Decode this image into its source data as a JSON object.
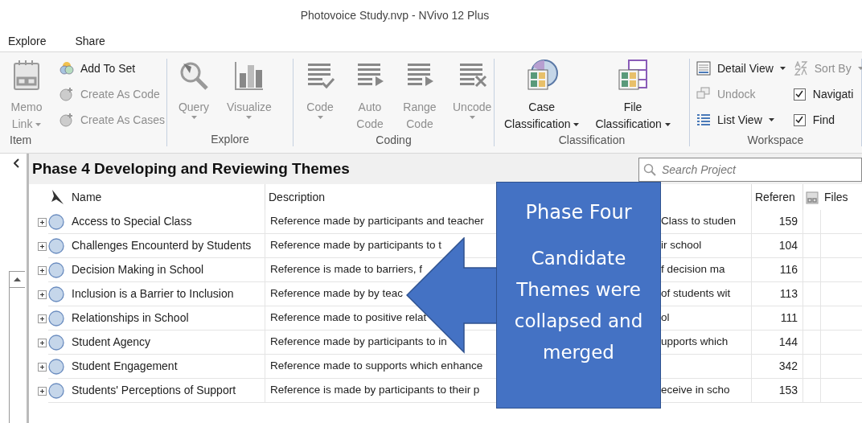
{
  "window": {
    "title": "Photovoice Study.nvp - NVivo 12 Plus"
  },
  "menu": [
    {
      "label": "Explore"
    },
    {
      "label": "Share"
    }
  ],
  "ribbon": [
    {
      "label": "Item",
      "items": [
        {
          "kind": "large",
          "lines": [
            "Memo",
            "Link"
          ],
          "dropdown": true,
          "disabled": true
        },
        {
          "kind": "stack",
          "entries": [
            {
              "label": "Add To Set",
              "dropdown": false,
              "disabled": false
            },
            {
              "label": "Create As Code",
              "dropdown": false,
              "disabled": true
            },
            {
              "label": "Create As Cases",
              "dropdown": false,
              "disabled": true
            }
          ]
        }
      ]
    },
    {
      "label": "Explore",
      "items": [
        {
          "kind": "large",
          "lines": [
            "Query"
          ],
          "dropdown": true,
          "disabled": true
        },
        {
          "kind": "large",
          "lines": [
            "Visualize"
          ],
          "dropdown": true,
          "disabled": true
        }
      ]
    },
    {
      "label": "Coding",
      "items": [
        {
          "kind": "large",
          "lines": [
            "Code"
          ],
          "dropdown": true,
          "disabled": true
        },
        {
          "kind": "large",
          "lines": [
            "Auto",
            "Code"
          ],
          "dropdown": false,
          "disabled": true
        },
        {
          "kind": "large",
          "lines": [
            "Range",
            "Code"
          ],
          "dropdown": false,
          "disabled": true
        },
        {
          "kind": "large",
          "lines": [
            "Uncode"
          ],
          "dropdown": true,
          "disabled": true
        }
      ]
    },
    {
      "label": "Classification",
      "items": [
        {
          "kind": "large",
          "lines": [
            "Case",
            "Classification"
          ],
          "dropdown": true,
          "disabled": false
        },
        {
          "kind": "large",
          "lines": [
            "File",
            "Classification"
          ],
          "dropdown": true,
          "disabled": false
        }
      ]
    },
    {
      "label": "Workspace",
      "items": [
        {
          "kind": "stack",
          "entries": [
            {
              "label": "Detail View",
              "dropdown": true,
              "disabled": false
            },
            {
              "label": "Undock",
              "dropdown": false,
              "disabled": true
            },
            {
              "label": "List View",
              "dropdown": true,
              "disabled": false
            }
          ]
        },
        {
          "kind": "stack",
          "entries": [
            {
              "label": "Sort By",
              "dropdown": true,
              "disabled": true
            },
            {
              "kind": "check",
              "label": "Navigati",
              "checked": true
            },
            {
              "kind": "check",
              "label": "Find",
              "checked": true
            }
          ]
        }
      ]
    }
  ],
  "heading": "Phase 4 Developing and Reviewing Themes",
  "search": {
    "placeholder": "Search Project"
  },
  "table": {
    "columns": [
      "Name",
      "Description",
      "Referen",
      "Files"
    ],
    "rows": [
      {
        "name": "Access to Special Class",
        "expanded": false,
        "desc_left": "Reference made by participants and teacher",
        "desc_right": "Class to studen",
        "references": "159"
      },
      {
        "name": "Challenges Encounterd by Students",
        "expanded": false,
        "desc_left": "Reference made by participants to t",
        "desc_right": "ir school",
        "references": "104"
      },
      {
        "name": "Decision Making in School",
        "expanded": false,
        "desc_left": "Reference is made to barriers, f",
        "desc_right": "f  decision ma",
        "references": "116"
      },
      {
        "name": "Inclusion is a Barrier to Inclusion",
        "expanded": false,
        "desc_left": "Reference made by by teac",
        "desc_right": "of students wit",
        "references": "113"
      },
      {
        "name": "Relationships in School",
        "expanded": false,
        "desc_left": "Reference made to positive relat",
        "desc_right": "ol",
        "references": "111"
      },
      {
        "name": "Student Agency",
        "expanded": false,
        "desc_left": "Reference made by participants to in",
        "desc_right": "upports  which",
        "references": "144"
      },
      {
        "name": "Student Engagement",
        "expanded": false,
        "desc_left": "Reference made to supports which enhance",
        "references": "342"
      },
      {
        "name": "Students' Perceptions of Support",
        "expanded": false,
        "desc_left": "Reference is made by participants to their p",
        "desc_right": "eceive in scho",
        "references": "153"
      }
    ]
  },
  "callout": {
    "title": "Phase Four",
    "body": "Candidate Themes were collapsed and merged"
  }
}
